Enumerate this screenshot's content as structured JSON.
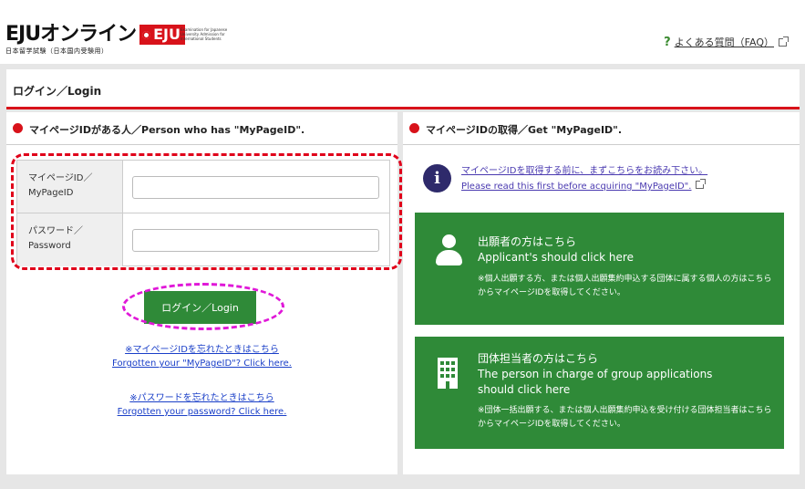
{
  "header": {
    "logo_text": "EJUオンライン",
    "logo_badge": "EJU",
    "logo_sub": "日本留学試験（日本国内受験用）",
    "logo_sub_en": "Examination for Japanese University Admission for International Students",
    "faq_label": "よくある質問（FAQ）"
  },
  "login": {
    "title": "ログイン／Login"
  },
  "left_panel": {
    "heading": "マイページIDがある人／Person who has \"MyPageID\".",
    "mypageid_label_line1": "マイページID／",
    "mypageid_label_line2": "MyPageID",
    "mypageid_value": "",
    "password_label_line1": "パスワード／",
    "password_label_line2": "Password",
    "password_value": "",
    "login_button": "ログイン／Login",
    "forgot_id_ja": "※マイページIDを忘れたときはこちら",
    "forgot_id_en": "Forgotten your \"MyPageID\"? Click here.",
    "forgot_pw_ja": "※パスワードを忘れたときはこちら",
    "forgot_pw_en": "Forgotten your password? Click here."
  },
  "right_panel": {
    "heading": "マイページIDの取得／Get \"MyPageID\".",
    "info_ja": "マイページIDを取得する前に、まずこちらをお読み下さい。",
    "info_en": "Please read this first before acquiring \"MyPageID\".",
    "applicant_title_ja": "出願者の方はこちら",
    "applicant_title_en": "Applicant's should click here",
    "applicant_note": "※個人出願する方、または個人出願集約申込する団体に属する個人の方はこちらからマイページIDを取得してください。",
    "group_title_ja": "団体担当者の方はこちら",
    "group_title_en1": "The person in charge of group applications",
    "group_title_en2": "should click here",
    "group_note": "※団体一括出願する、または個人出願集約申込を受け付ける団体担当者はこちらからマイページIDを取得してください。"
  },
  "colors": {
    "accent_red": "#d8121a",
    "button_green": "#2f8a38",
    "link_blue": "#1a3fc8",
    "annotation_red": "#e0001a",
    "annotation_magenta": "#e018d8"
  }
}
